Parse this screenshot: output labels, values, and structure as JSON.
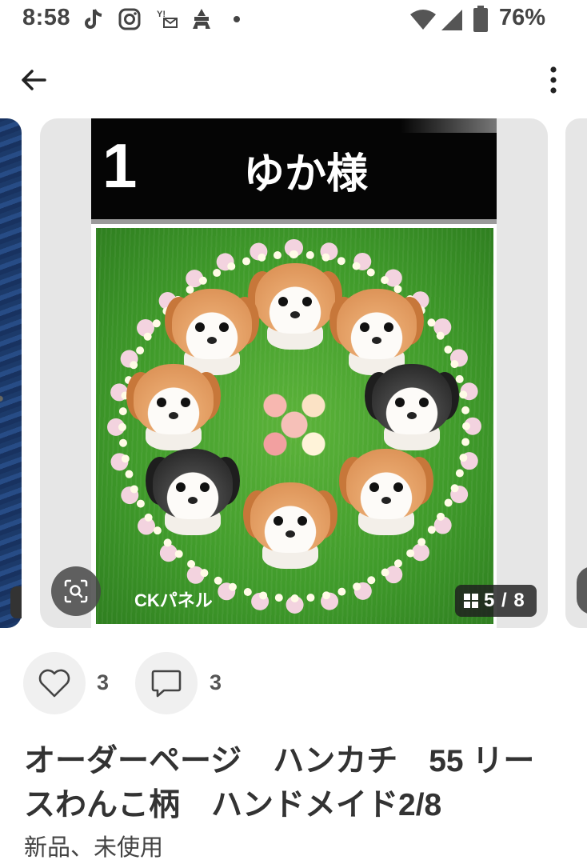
{
  "status_bar": {
    "time": "8:58",
    "battery": "76%",
    "notification_icons": [
      "tiktok-icon",
      "instagram-icon",
      "yahoo-mail-icon",
      "castle-icon",
      "dot-icon"
    ],
    "system_icons": [
      "wifi-icon",
      "cell-signal-icon",
      "battery-icon"
    ]
  },
  "app_bar": {
    "back_icon": "arrow-left-icon",
    "more_icon": "more-vert-icon"
  },
  "carousel": {
    "current_image": {
      "order_number": "1",
      "customer_name": "ゆか様",
      "watermark": "CKパネル"
    },
    "page_counter": "5 / 8",
    "current_page": 5,
    "total_pages": 8,
    "lens_icon": "image-search-icon"
  },
  "actions": {
    "like_icon": "heart-outline-icon",
    "like_count": "3",
    "comment_icon": "comment-outline-icon",
    "comment_count": "3"
  },
  "product": {
    "title": "オーダーページ　ハンカチ　55 リースわんこ柄　ハンドメイド2/8",
    "condition": "新品、未使用"
  },
  "colors": {
    "background": "#ffffff",
    "card_bg": "#e6e6e6",
    "text_primary": "#333333",
    "action_circle": "#f0f0f0"
  }
}
